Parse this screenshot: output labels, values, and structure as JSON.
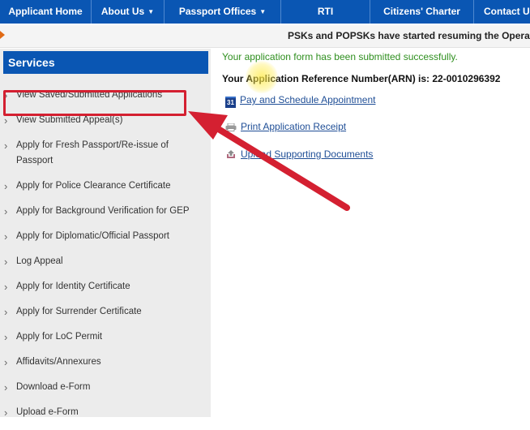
{
  "nav": {
    "items": [
      {
        "label": "Applicant Home",
        "caret": false
      },
      {
        "label": "About Us",
        "caret": true
      },
      {
        "label": "Passport Offices",
        "caret": true
      },
      {
        "label": "RTI",
        "caret": false
      },
      {
        "label": "Citizens' Charter",
        "caret": false
      },
      {
        "label": "Contact Us",
        "caret": false
      }
    ]
  },
  "ticker": {
    "text": "PSKs and POPSKs have started resuming the Operations"
  },
  "sidebar": {
    "title": "Services",
    "items": [
      "View Saved/Submitted Applications",
      "View Submitted Appeal(s)",
      "Apply for Fresh Passport/Re-issue of Passport",
      "Apply for Police Clearance Certificate",
      "Apply for Background Verification for GEP",
      "Apply for Diplomatic/Official Passport",
      "Log Appeal",
      "Apply for Identity Certificate",
      "Apply for Surrender Certificate",
      "Apply for LoC Permit",
      "Affidavits/Annexures",
      "Download e-Form",
      "Upload e-Form"
    ]
  },
  "main": {
    "success_message": "Your application form has been submitted successfully.",
    "arn_text": "Your Application Reference Number(ARN) is: 22-0010296392",
    "actions": {
      "pay": "Pay and Schedule Appointment",
      "print": "Print Application Receipt",
      "upload": "Upload Supporting Documents"
    },
    "calendar_icon_text": "31"
  },
  "colors": {
    "brand_blue": "#0a56b3",
    "success_green": "#2f8f1f",
    "link_blue": "#1f4e96",
    "annotation_red": "#d42031"
  }
}
